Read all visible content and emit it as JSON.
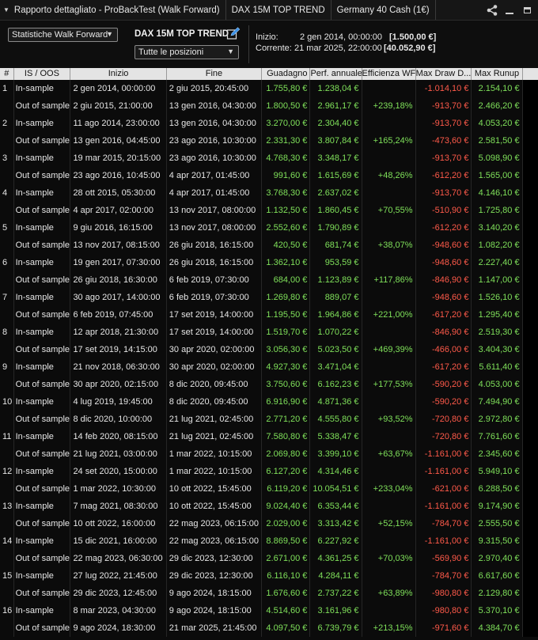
{
  "titlebar": {
    "report_tab": "Rapporto dettagliato - ProBackTest (Walk Forward)",
    "strategy_tab": "DAX 15M TOP TREND",
    "instrument_tab": "Germany 40 Cash (1€)"
  },
  "toolbar": {
    "view_select": "Statistiche Walk Forward",
    "strategy_title": "DAX 15M TOP TREND",
    "positions_select": "Tutte le posizioni",
    "start_label": "Inizio:",
    "start_date": "2 gen 2014, 00:00:00",
    "start_value": "[1.500,00 €]",
    "current_label": "Corrente:",
    "current_date": "21 mar 2025, 22:00:00",
    "current_value": "[40.052,90 €]"
  },
  "columns": [
    "#",
    "IS / OOS",
    "Inizio",
    "Fine",
    "Guadagno",
    "Perf. annuale",
    "Efficienza WF",
    "Max Draw D...",
    "Max Runup"
  ],
  "rows": [
    {
      "num": "1",
      "type": "In-sample",
      "start": "2 gen 2014, 00:00:00",
      "end": "2 giu 2015, 20:45:00",
      "gain": "1.755,80 €",
      "perf": "1.238,04 €",
      "eff": "",
      "dd": "-1.014,10 €",
      "runup": "2.154,10 €"
    },
    {
      "num": "",
      "type": "Out of sample",
      "start": "2 giu 2015, 21:00:00",
      "end": "13 gen 2016, 04:30:00",
      "gain": "1.800,50 €",
      "perf": "2.961,17 €",
      "eff": "+239,18%",
      "dd": "-913,70 €",
      "runup": "2.466,20 €"
    },
    {
      "num": "2",
      "type": "In-sample",
      "start": "11 ago 2014, 23:00:00",
      "end": "13 gen 2016, 04:30:00",
      "gain": "3.270,00 €",
      "perf": "2.304,40 €",
      "eff": "",
      "dd": "-913,70 €",
      "runup": "4.053,20 €"
    },
    {
      "num": "",
      "type": "Out of sample",
      "start": "13 gen 2016, 04:45:00",
      "end": "23 ago 2016, 10:30:00",
      "gain": "2.331,30 €",
      "perf": "3.807,84 €",
      "eff": "+165,24%",
      "dd": "-473,60 €",
      "runup": "2.581,50 €"
    },
    {
      "num": "3",
      "type": "In-sample",
      "start": "19 mar 2015, 20:15:00",
      "end": "23 ago 2016, 10:30:00",
      "gain": "4.768,30 €",
      "perf": "3.348,17 €",
      "eff": "",
      "dd": "-913,70 €",
      "runup": "5.098,90 €"
    },
    {
      "num": "",
      "type": "Out of sample",
      "start": "23 ago 2016, 10:45:00",
      "end": "4 apr 2017, 01:45:00",
      "gain": "991,60 €",
      "perf": "1.615,69 €",
      "eff": "+48,26%",
      "dd": "-612,20 €",
      "runup": "1.565,00 €"
    },
    {
      "num": "4",
      "type": "In-sample",
      "start": "28 ott 2015, 05:30:00",
      "end": "4 apr 2017, 01:45:00",
      "gain": "3.768,30 €",
      "perf": "2.637,02 €",
      "eff": "",
      "dd": "-913,70 €",
      "runup": "4.146,10 €"
    },
    {
      "num": "",
      "type": "Out of sample",
      "start": "4 apr 2017, 02:00:00",
      "end": "13 nov 2017, 08:00:00",
      "gain": "1.132,50 €",
      "perf": "1.860,45 €",
      "eff": "+70,55%",
      "dd": "-510,90 €",
      "runup": "1.725,80 €"
    },
    {
      "num": "5",
      "type": "In-sample",
      "start": "9 giu 2016, 16:15:00",
      "end": "13 nov 2017, 08:00:00",
      "gain": "2.552,60 €",
      "perf": "1.790,89 €",
      "eff": "",
      "dd": "-612,20 €",
      "runup": "3.140,20 €"
    },
    {
      "num": "",
      "type": "Out of sample",
      "start": "13 nov 2017, 08:15:00",
      "end": "26 giu 2018, 16:15:00",
      "gain": "420,50 €",
      "perf": "681,74 €",
      "eff": "+38,07%",
      "dd": "-948,60 €",
      "runup": "1.082,20 €"
    },
    {
      "num": "6",
      "type": "In-sample",
      "start": "19 gen 2017, 07:30:00",
      "end": "26 giu 2018, 16:15:00",
      "gain": "1.362,10 €",
      "perf": "953,59 €",
      "eff": "",
      "dd": "-948,60 €",
      "runup": "2.227,40 €"
    },
    {
      "num": "",
      "type": "Out of sample",
      "start": "26 giu 2018, 16:30:00",
      "end": "6 feb 2019, 07:30:00",
      "gain": "684,00 €",
      "perf": "1.123,89 €",
      "eff": "+117,86%",
      "dd": "-846,90 €",
      "runup": "1.147,00 €"
    },
    {
      "num": "7",
      "type": "In-sample",
      "start": "30 ago 2017, 14:00:00",
      "end": "6 feb 2019, 07:30:00",
      "gain": "1.269,80 €",
      "perf": "889,07 €",
      "eff": "",
      "dd": "-948,60 €",
      "runup": "1.526,10 €"
    },
    {
      "num": "",
      "type": "Out of sample",
      "start": "6 feb 2019, 07:45:00",
      "end": "17 set 2019, 14:00:00",
      "gain": "1.195,50 €",
      "perf": "1.964,86 €",
      "eff": "+221,00%",
      "dd": "-617,20 €",
      "runup": "1.295,40 €"
    },
    {
      "num": "8",
      "type": "In-sample",
      "start": "12 apr 2018, 21:30:00",
      "end": "17 set 2019, 14:00:00",
      "gain": "1.519,70 €",
      "perf": "1.070,22 €",
      "eff": "",
      "dd": "-846,90 €",
      "runup": "2.519,30 €"
    },
    {
      "num": "",
      "type": "Out of sample",
      "start": "17 set 2019, 14:15:00",
      "end": "30 apr 2020, 02:00:00",
      "gain": "3.056,30 €",
      "perf": "5.023,50 €",
      "eff": "+469,39%",
      "dd": "-466,00 €",
      "runup": "3.404,30 €"
    },
    {
      "num": "9",
      "type": "In-sample",
      "start": "21 nov 2018, 06:30:00",
      "end": "30 apr 2020, 02:00:00",
      "gain": "4.927,30 €",
      "perf": "3.471,04 €",
      "eff": "",
      "dd": "-617,20 €",
      "runup": "5.611,40 €"
    },
    {
      "num": "",
      "type": "Out of sample",
      "start": "30 apr 2020, 02:15:00",
      "end": "8 dic 2020, 09:45:00",
      "gain": "3.750,60 €",
      "perf": "6.162,23 €",
      "eff": "+177,53%",
      "dd": "-590,20 €",
      "runup": "4.053,00 €"
    },
    {
      "num": "10",
      "type": "In-sample",
      "start": "4 lug 2019, 19:45:00",
      "end": "8 dic 2020, 09:45:00",
      "gain": "6.916,90 €",
      "perf": "4.871,36 €",
      "eff": "",
      "dd": "-590,20 €",
      "runup": "7.494,90 €"
    },
    {
      "num": "",
      "type": "Out of sample",
      "start": "8 dic 2020, 10:00:00",
      "end": "21 lug 2021, 02:45:00",
      "gain": "2.771,20 €",
      "perf": "4.555,80 €",
      "eff": "+93,52%",
      "dd": "-720,80 €",
      "runup": "2.972,80 €"
    },
    {
      "num": "11",
      "type": "In-sample",
      "start": "14 feb 2020, 08:15:00",
      "end": "21 lug 2021, 02:45:00",
      "gain": "7.580,80 €",
      "perf": "5.338,47 €",
      "eff": "",
      "dd": "-720,80 €",
      "runup": "7.761,60 €"
    },
    {
      "num": "",
      "type": "Out of sample",
      "start": "21 lug 2021, 03:00:00",
      "end": "1 mar 2022, 10:15:00",
      "gain": "2.069,80 €",
      "perf": "3.399,10 €",
      "eff": "+63,67%",
      "dd": "-1.161,00 €",
      "runup": "2.345,60 €"
    },
    {
      "num": "12",
      "type": "In-sample",
      "start": "24 set 2020, 15:00:00",
      "end": "1 mar 2022, 10:15:00",
      "gain": "6.127,20 €",
      "perf": "4.314,46 €",
      "eff": "",
      "dd": "-1.161,00 €",
      "runup": "5.949,10 €"
    },
    {
      "num": "",
      "type": "Out of sample",
      "start": "1 mar 2022, 10:30:00",
      "end": "10 ott 2022, 15:45:00",
      "gain": "6.119,20 €",
      "perf": "10.054,51 €",
      "eff": "+233,04%",
      "dd": "-621,00 €",
      "runup": "6.288,50 €"
    },
    {
      "num": "13",
      "type": "In-sample",
      "start": "7 mag 2021, 08:30:00",
      "end": "10 ott 2022, 15:45:00",
      "gain": "9.024,40 €",
      "perf": "6.353,44 €",
      "eff": "",
      "dd": "-1.161,00 €",
      "runup": "9.174,90 €"
    },
    {
      "num": "",
      "type": "Out of sample",
      "start": "10 ott 2022, 16:00:00",
      "end": "22 mag 2023, 06:15:00",
      "gain": "2.029,00 €",
      "perf": "3.313,42 €",
      "eff": "+52,15%",
      "dd": "-784,70 €",
      "runup": "2.555,50 €"
    },
    {
      "num": "14",
      "type": "In-sample",
      "start": "15 dic 2021, 16:00:00",
      "end": "22 mag 2023, 06:15:00",
      "gain": "8.869,50 €",
      "perf": "6.227,92 €",
      "eff": "",
      "dd": "-1.161,00 €",
      "runup": "9.315,50 €"
    },
    {
      "num": "",
      "type": "Out of sample",
      "start": "22 mag 2023, 06:30:00",
      "end": "29 dic 2023, 12:30:00",
      "gain": "2.671,00 €",
      "perf": "4.361,25 €",
      "eff": "+70,03%",
      "dd": "-569,90 €",
      "runup": "2.970,40 €"
    },
    {
      "num": "15",
      "type": "In-sample",
      "start": "27 lug 2022, 21:45:00",
      "end": "29 dic 2023, 12:30:00",
      "gain": "6.116,10 €",
      "perf": "4.284,11 €",
      "eff": "",
      "dd": "-784,70 €",
      "runup": "6.617,60 €"
    },
    {
      "num": "",
      "type": "Out of sample",
      "start": "29 dic 2023, 12:45:00",
      "end": "9 ago 2024, 18:15:00",
      "gain": "1.676,60 €",
      "perf": "2.737,22 €",
      "eff": "+63,89%",
      "dd": "-980,80 €",
      "runup": "2.129,80 €"
    },
    {
      "num": "16",
      "type": "In-sample",
      "start": "8 mar 2023, 04:30:00",
      "end": "9 ago 2024, 18:15:00",
      "gain": "4.514,60 €",
      "perf": "3.161,96 €",
      "eff": "",
      "dd": "-980,80 €",
      "runup": "5.370,10 €"
    },
    {
      "num": "",
      "type": "Out of sample",
      "start": "9 ago 2024, 18:30:00",
      "end": "21 mar 2025, 21:45:00",
      "gain": "4.097,50 €",
      "perf": "6.739,79 €",
      "eff": "+213,15%",
      "dd": "-971,60 €",
      "runup": "4.384,70 €"
    }
  ]
}
